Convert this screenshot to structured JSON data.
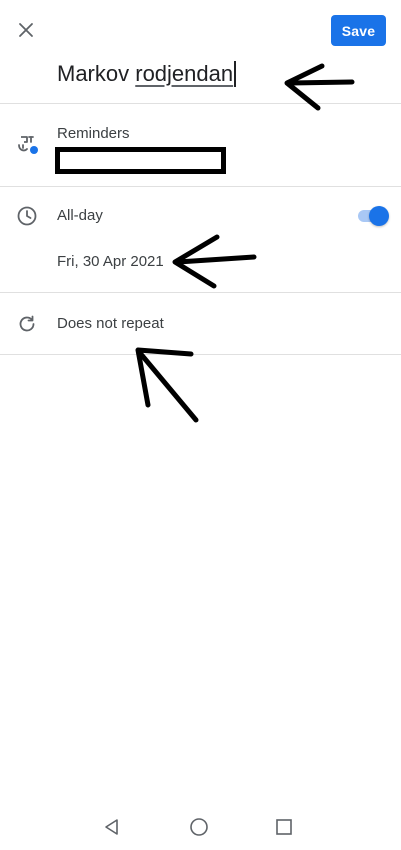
{
  "app": {
    "accent_color": "#1a73e8",
    "toggle_track_color": "#a9c8f5",
    "icon_color": "#5f6368"
  },
  "toolbar": {
    "close_icon": "close-icon",
    "save_label": "Save"
  },
  "event": {
    "title_word_1": "Markov",
    "title_word_2": "rodjendan"
  },
  "reminders": {
    "icon": "reminders-icon",
    "label": "Reminders",
    "badge_color": "#1a73e8"
  },
  "allday": {
    "icon": "clock-icon",
    "label": "All-day",
    "enabled": true,
    "date": "Fri, 30 Apr 2021"
  },
  "repeat": {
    "icon": "repeat-icon",
    "label": "Does not repeat"
  },
  "navigation": {
    "back_icon": "back-triangle-icon",
    "home_icon": "home-circle-icon",
    "recents_icon": "recents-square-icon"
  }
}
